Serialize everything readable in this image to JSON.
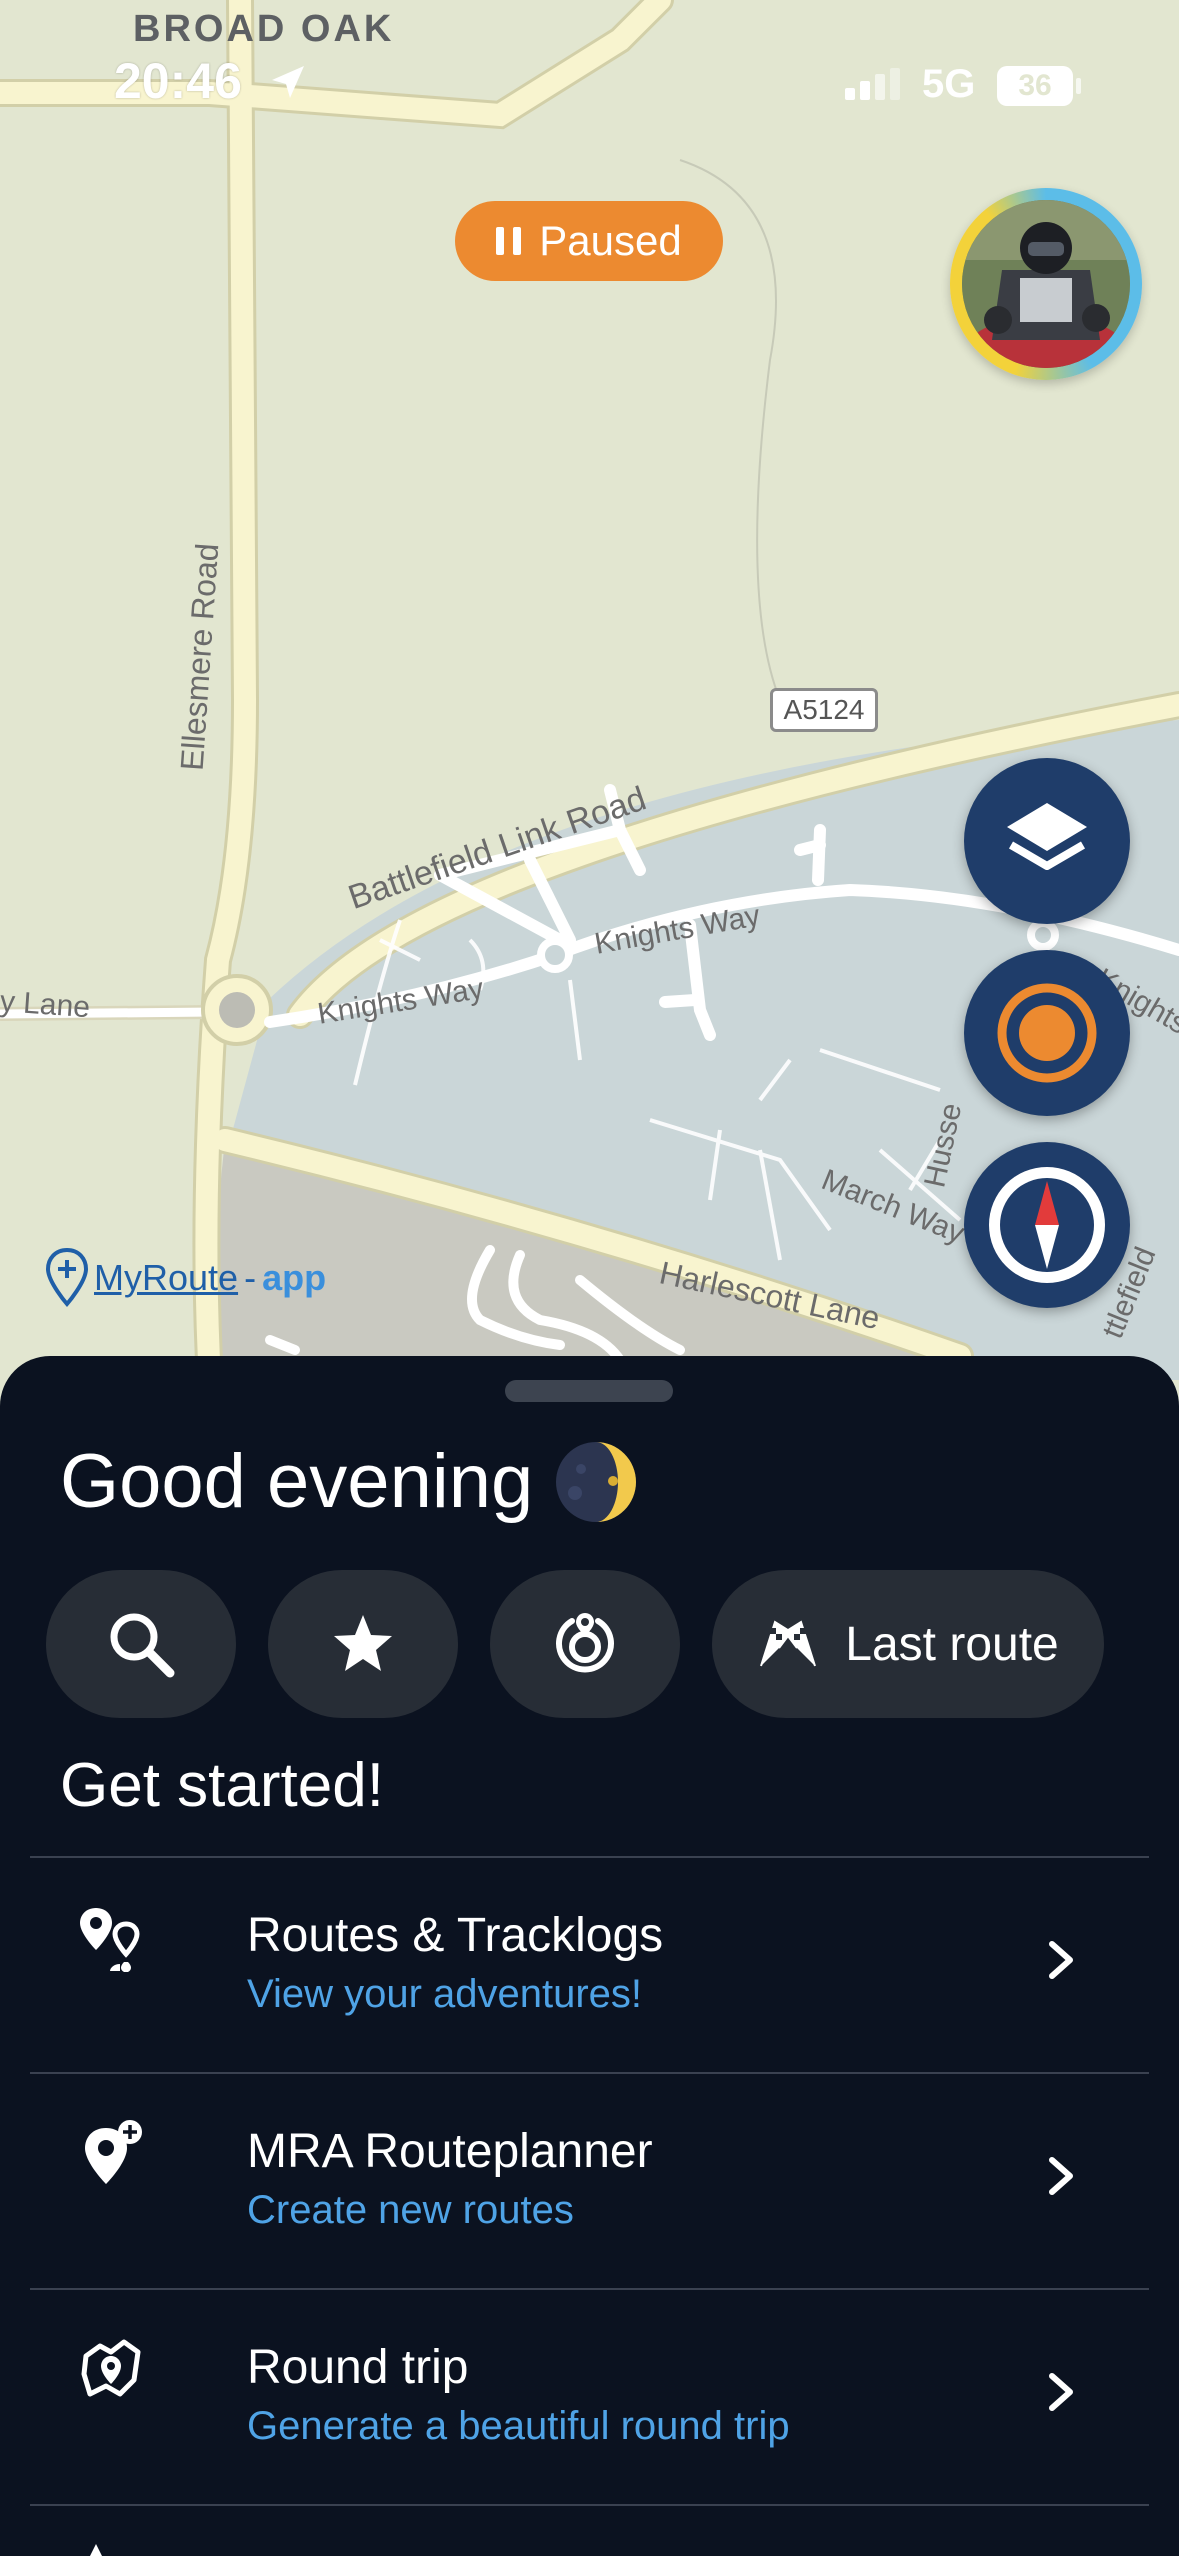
{
  "status_bar": {
    "location_name": "BROAD OAK",
    "time": "20:46",
    "network": "5G",
    "battery": "36"
  },
  "map": {
    "state_pill": "Paused",
    "road_badge": "A5124",
    "labels": {
      "ellesmere": "Ellesmere Road",
      "battlefield": "Battlefield Link Road",
      "knights_way_1": "Knights Way",
      "knights_way_2": "Knights Way",
      "lane_left": "y Lane",
      "knights_right": "Knights",
      "husse": "Husse",
      "march_way": "March Way",
      "harlescott": "Harlescott Lane",
      "battlefield_right": "ttlefield"
    },
    "brand": {
      "main": "MyRoute",
      "dash": "-",
      "app": "app"
    }
  },
  "sheet": {
    "greeting": "Good evening",
    "quick_actions": {
      "last_route": "Last route"
    },
    "section_title": "Get started!",
    "rows": [
      {
        "title": "Routes & Tracklogs",
        "subtitle": "View your adventures!",
        "icon": "pins-icon"
      },
      {
        "title": "MRA Routeplanner",
        "subtitle": "Create new routes",
        "icon": "add-location-icon"
      },
      {
        "title": "Round trip",
        "subtitle": "Generate a beautiful round trip",
        "icon": "round-trip-icon"
      }
    ]
  },
  "colors": {
    "map_background": "#e2e6d0",
    "map_residential": "#cad6d8",
    "paused_pill": "#ec8a30",
    "map_button": "#1f3d6a",
    "sheet_background": "#0b1220",
    "chip_background": "#272d36",
    "subtitle_blue": "#4fa3e6"
  }
}
